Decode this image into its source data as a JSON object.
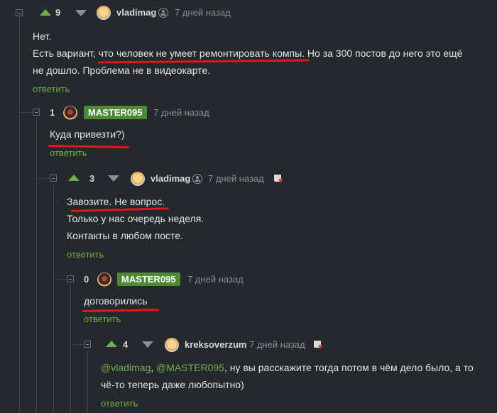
{
  "comments": [
    {
      "rating": "9",
      "author": "vladimag",
      "time": "7 дней назад",
      "lines": [
        "Нет.",
        "Есть вариант, что человек не умеет ремонтировать компы. Но за 300 постов до него это ещё",
        "не дошло. Проблема не в видеокарте."
      ],
      "reply": "ответить"
    },
    {
      "rating": "1",
      "author": "MASTER095",
      "time": "7 дней назад",
      "lines": [
        "Куда привезти?)"
      ],
      "reply": "ответить"
    },
    {
      "rating": "3",
      "author": "vladimag",
      "time": "7 дней назад",
      "lines": [
        "Завозите. Не вопрос.",
        "Только у нас очередь неделя.",
        "Контакты в любом посте."
      ],
      "reply": "ответить"
    },
    {
      "rating": "0",
      "author": "MASTER095",
      "time": "7 дней назад",
      "lines": [
        "договорились"
      ],
      "reply": "ответить"
    },
    {
      "rating": "4",
      "author": "kreksoverzum",
      "time": "7 дней назад",
      "mention1": "@vladimag",
      "sep": ", ",
      "mention2": "@MASTER095",
      "line1_rest": ", ну вы расскажите тогда потом в чём дело было, а то",
      "line2": "чё-то теперь даже любопытно)",
      "reply": "ответить"
    }
  ],
  "colors": {
    "background": "#25282c",
    "accent_green": "#6fae4c",
    "badge_green": "#4d8a35",
    "underline_red": "#e01818",
    "muted": "#8b8f94"
  },
  "icons": {
    "upvote": "triangle-up",
    "downvote": "triangle-down",
    "collapse": "minus-square",
    "user": "user-circle",
    "award": "award-figure-heart"
  }
}
